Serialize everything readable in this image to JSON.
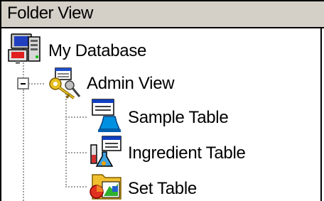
{
  "panel": {
    "title": "Folder View"
  },
  "tree": {
    "root": {
      "label": "My Database",
      "icon": "database-server-icon"
    },
    "admin_view": {
      "label": "Admin View",
      "icon": "admin-keys-icon",
      "expanded": true
    },
    "children": [
      {
        "label": "Sample Table",
        "icon": "sample-table-icon"
      },
      {
        "label": "Ingredient Table",
        "icon": "ingredient-table-icon"
      },
      {
        "label": "Set Table",
        "icon": "set-table-icon"
      }
    ]
  }
}
